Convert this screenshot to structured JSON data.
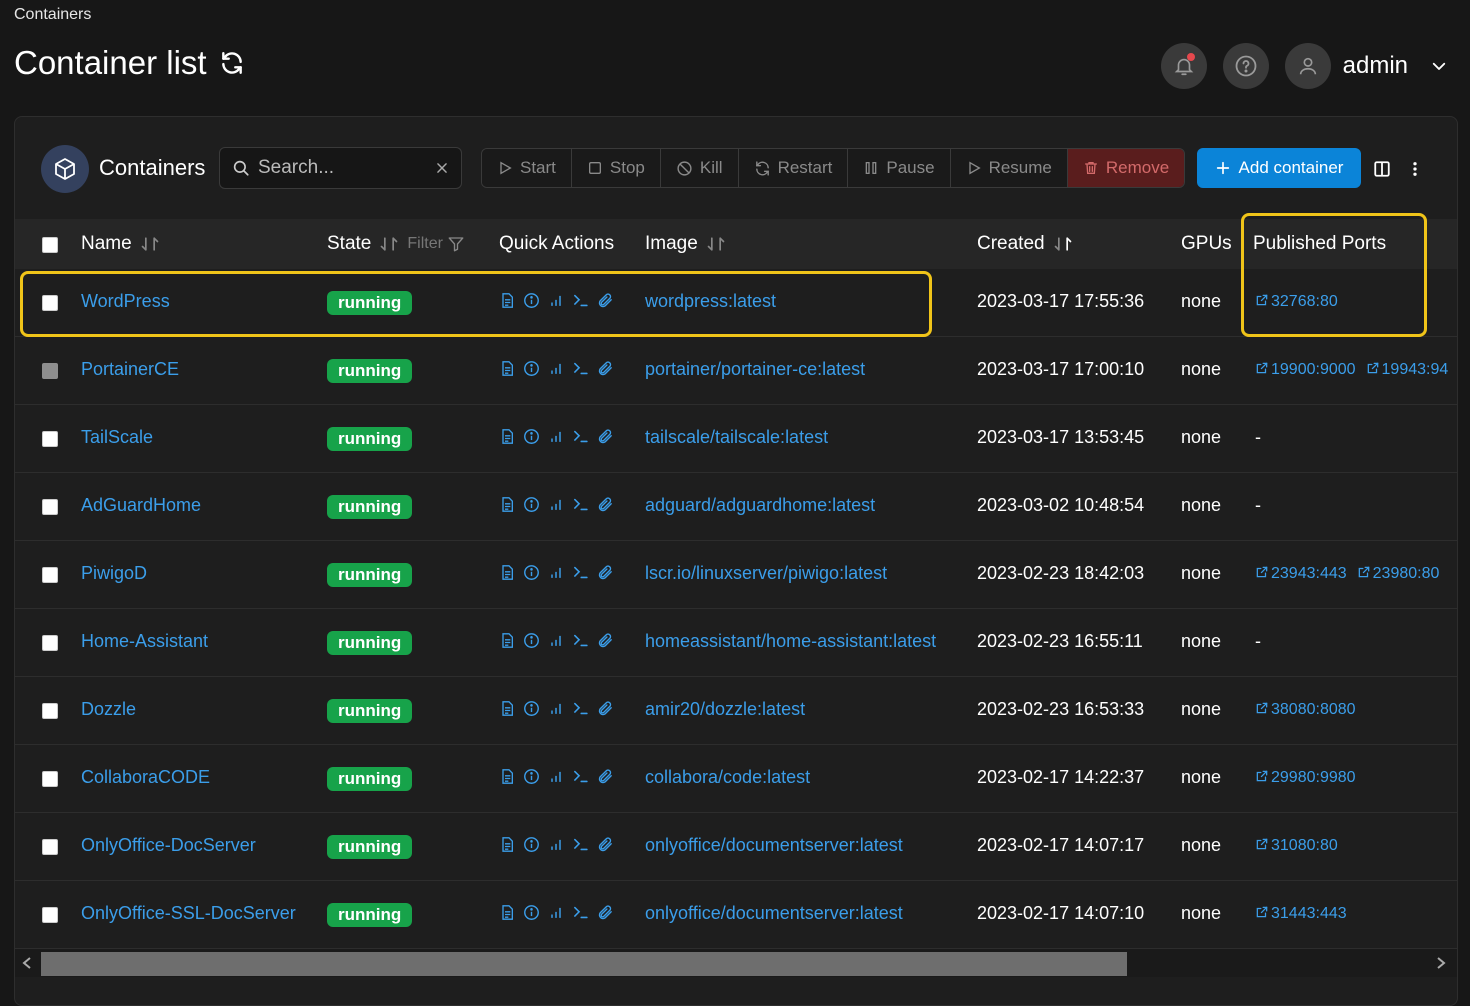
{
  "breadcrumb": "Containers",
  "page_title": "Container list",
  "header": {
    "user_name": "admin"
  },
  "panel": {
    "title": "Containers",
    "search_placeholder": "Search...",
    "actions": {
      "start": "Start",
      "stop": "Stop",
      "kill": "Kill",
      "restart": "Restart",
      "pause": "Pause",
      "resume": "Resume",
      "remove": "Remove"
    },
    "add_label": "Add container"
  },
  "table": {
    "headers": {
      "name": "Name",
      "state": "State",
      "filter": "Filter",
      "quick_actions": "Quick Actions",
      "image": "Image",
      "created": "Created",
      "gpus": "GPUs",
      "ports": "Published Ports"
    },
    "rows": [
      {
        "name": "WordPress",
        "state": "running",
        "image": "wordpress:latest",
        "created": "2023-03-17 17:55:36",
        "gpus": "none",
        "port1": "32768:80",
        "port2": "",
        "no_ports": ""
      },
      {
        "name": "PortainerCE",
        "state": "running",
        "image": "portainer/portainer-ce:latest",
        "created": "2023-03-17 17:00:10",
        "gpus": "none",
        "port1": "19900:9000",
        "port2": "19943:94",
        "no_ports": ""
      },
      {
        "name": "TailScale",
        "state": "running",
        "image": "tailscale/tailscale:latest",
        "created": "2023-03-17 13:53:45",
        "gpus": "none",
        "port1": "",
        "port2": "",
        "no_ports": "-"
      },
      {
        "name": "AdGuardHome",
        "state": "running",
        "image": "adguard/adguardhome:latest",
        "created": "2023-03-02 10:48:54",
        "gpus": "none",
        "port1": "",
        "port2": "",
        "no_ports": "-"
      },
      {
        "name": "PiwigoD",
        "state": "running",
        "image": "lscr.io/linuxserver/piwigo:latest",
        "created": "2023-02-23 18:42:03",
        "gpus": "none",
        "port1": "23943:443",
        "port2": "23980:80",
        "no_ports": ""
      },
      {
        "name": "Home-Assistant",
        "state": "running",
        "image": "homeassistant/home-assistant:latest",
        "created": "2023-02-23 16:55:11",
        "gpus": "none",
        "port1": "",
        "port2": "",
        "no_ports": "-"
      },
      {
        "name": "Dozzle",
        "state": "running",
        "image": "amir20/dozzle:latest",
        "created": "2023-02-23 16:53:33",
        "gpus": "none",
        "port1": "38080:8080",
        "port2": "",
        "no_ports": ""
      },
      {
        "name": "CollaboraCODE",
        "state": "running",
        "image": "collabora/code:latest",
        "created": "2023-02-17 14:22:37",
        "gpus": "none",
        "port1": "29980:9980",
        "port2": "",
        "no_ports": ""
      },
      {
        "name": "OnlyOffice-DocServer",
        "state": "running",
        "image": "onlyoffice/documentserver:latest",
        "created": "2023-02-17 14:07:17",
        "gpus": "none",
        "port1": "31080:80",
        "port2": "",
        "no_ports": ""
      },
      {
        "name": "OnlyOffice-SSL-DocServer",
        "state": "running",
        "image": "onlyoffice/documentserver:latest",
        "created": "2023-02-17 14:07:10",
        "gpus": "none",
        "port1": "31443:443",
        "port2": "",
        "no_ports": ""
      }
    ]
  },
  "colors": {
    "accent": "#0b84d8",
    "link": "#3b9eea",
    "running": "#17a34a",
    "highlight": "#f0c419"
  }
}
